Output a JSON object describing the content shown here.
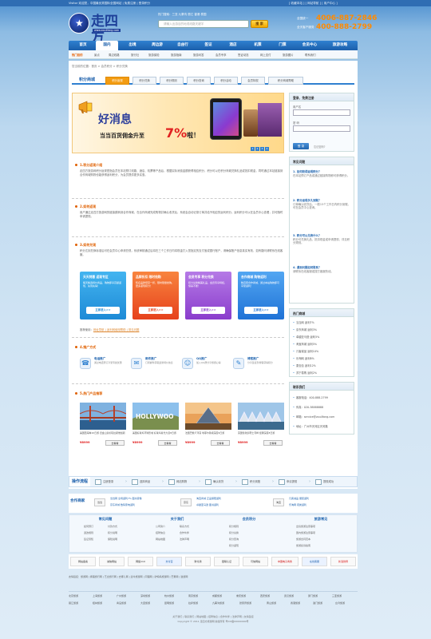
{
  "topbar": {
    "left": "Visitor 欢迎您，中国最优秀国际全国网站 | 免费注册 | 登录积分",
    "right": "[ 收藏本站 ] [ 网站导航 ] [ 用户中心 ]"
  },
  "logo": {
    "word": "走四方",
    "url": "www.zou4fang.com"
  },
  "search": {
    "hint": "热门搜索：三亚 九寨沟 丽江 香港 泰国",
    "placeholder": "请输入出游目的地或线路关键字",
    "button": "搜 索"
  },
  "hotline": [
    {
      "label": "全国统一",
      "number": "4006-887-2846"
    },
    {
      "label": "全天客户服务",
      "number": "400-888-2799"
    }
  ],
  "nav": [
    "首页",
    "国内",
    "出境",
    "周边游",
    "自由行",
    "签证",
    "酒店",
    "机票",
    "门票",
    "会员中心",
    "旅游攻略"
  ],
  "subnav": [
    "热门目的",
    "景点",
    "周边线路",
    "旅行社",
    "旅游保险",
    "旅游指南",
    "旅游问答",
    "会员专享",
    "签证动态",
    "网上支付",
    "旅游图片",
    "联系我们"
  ],
  "breadcrumb": "您当前的位置：首页 > 会员积分 > 积分兑换",
  "tabs": {
    "head": "积分商城",
    "items": [
      "积分返现",
      "积分兑换",
      "积分规则",
      "积分查询",
      "积分活动",
      "会员特权",
      "积分商城帮助"
    ]
  },
  "banner": {
    "title": "好消息",
    "sub": "当当百货佣金升至",
    "pct": "7%",
    "suffix": "啦！",
    "dots": [
      "1",
      "2",
      "3",
      "4"
    ]
  },
  "login": {
    "title": "登录、免费注册",
    "user_label": "用户名",
    "pass_label": "密 码",
    "login_btn": "登 录",
    "forgot": "忘记密码?"
  },
  "sections": [
    {
      "title": "1.积分返现介绍",
      "text": "走四方旅游网积分返现是指会员在本站预订线路、酒店、机票等产品后，根据实际消费金额获得相应积分，积分可以在积分商城兑换礼品或抵扣现金，同时通过本站链接到合作商城购物也能获得返利积分，为会员提供更多实惠。"
    },
    {
      "title": "2.如何返现",
      "text": "用户通过走四方旅游网的链接跳转到合作商城，在合作商城完成购物并确认收货后，系统会自动记录订单并给予相应的返利积分。返利积分可以在会员中心查看，并可随时申请提现。"
    },
    {
      "title": "3.如何兑现",
      "text": "积分达到兑换标准后可在会员中心申请兑现，系统审核通过后将在三个工作日内将现金打入您指定的支付宝或银行账户，请确保账户信息真实有效，如有疑问请联系在线客服。"
    },
    {
      "title": "4.推广方式",
      "text": ""
    },
    {
      "title": "5.热门产品推荐",
      "text": ""
    }
  ],
  "cards": [
    {
      "title": "天天特惠 返现专区",
      "text": "每天精选特价商品，购物即享高额返现，先到先得！",
      "button": "立即进入>>",
      "color": "#26a0e8"
    },
    {
      "title": "品牌折扣 限时抢购",
      "text": "知名品牌低至一折，限时限量抢购，更多返现积分！",
      "button": "立即进入>>",
      "color": "#f05a2a"
    },
    {
      "title": "会员专享 积分兑换",
      "text": "积分兑换精美礼品，会员专享特权，惊喜不断！",
      "button": "立即进入>>",
      "color": "#9a52d6"
    },
    {
      "title": "合作商城 购物返利",
      "text": "数百家合作商城，通过本站购物即可享受返利！",
      "button": "立即进入>>",
      "color": "#2f86e0"
    }
  ],
  "note": {
    "label": "推荐使用：",
    "link": "网址导航 | 返利网使用帮助 | 常见问题"
  },
  "promos": [
    {
      "icon": "☎",
      "title": "电话推广",
      "text": "通过电话预订享受专属优惠"
    },
    {
      "icon": "✉",
      "title": "邮件推广",
      "text": "订阅邮件获取最新特价信息"
    },
    {
      "icon": "☺",
      "title": "QQ推广",
      "text": "加入QQ群分享旅游心得"
    },
    {
      "icon": "✎",
      "title": "博客推广",
      "text": "分享链接到博客获得积分"
    }
  ],
  "products": [
    {
      "name": "美国西海岸10日游 旧金山洛杉矶拉斯维加斯",
      "price": "¥8999",
      "button": "去看看"
    },
    {
      "name": "美国好莱坞环球影城 好莱坞星光大道8日游",
      "price": "¥8999",
      "button": "去看看"
    },
    {
      "name": "法国巴黎卢浮宫 埃菲尔铁塔深度9日游",
      "price": "¥8999",
      "button": "去看看"
    },
    {
      "name": "英国伦敦泰晤士河畔 经典深度8日游",
      "price": "¥8999",
      "button": "去看看"
    }
  ],
  "faq": {
    "title": "常见问题",
    "items": [
      {
        "q": "1. 如何获得返现积分？",
        "a": "在本站预订产品或通过链接购物即可获得积分。"
      },
      {
        "q": "2. 积分返现多久到账？",
        "a": "订单确认收货后，一般15个工作日内积分到账，可在会员中心查询。"
      },
      {
        "q": "3. 积分可以兑换什么？",
        "a": "积分可兑换礼品、抵扣现金或申请提现，详见积分规则。"
      },
      {
        "q": "4. 遇到问题如何联系？",
        "a": "请联系在线客服或拨打客服热线。"
      }
    ]
  },
  "hot": {
    "title": "热门商城",
    "items": [
      "当当网 返利7%",
      "京东商城 返利3%",
      "卓越亚马逊 返利5%",
      "淘宝商城 返利5%",
      "凡客诚品 返利10%",
      "乐淘网 返利8%",
      "麦包包 返利12%",
      "苏宁易购 返利2%"
    ]
  },
  "contact": {
    "title": "联系我们",
    "items": [
      "客服电话：400-888-2799",
      "传真：020-38888888",
      "邮箱：service@zou4fang.com",
      "地址：广州市天河区天河路"
    ]
  },
  "flow": {
    "head": "操作流程",
    "steps": [
      "注册登录",
      "选择商品",
      "网站购物",
      "确认收货",
      "积分到账",
      "申请提现",
      "提现成功"
    ]
  },
  "partner": {
    "head": "合作商家",
    "logos": [
      "当当",
      "京东",
      "淘宝"
    ],
    "lines": [
      "当当网 全场返利7% 图书音像",
      "京东商城 数码家电返利",
      "淘宝商城 正品保障返利",
      "卓越亚马逊 图书返利",
      "凡客诚品 服装返利",
      "乐淘网 鞋类返利"
    ]
  },
  "footcols": [
    {
      "title": "常见问题",
      "items": [
        "如何预订",
        "付款方式",
        "退改规则",
        "积分说明",
        "签证须知",
        "保险说明"
      ]
    },
    {
      "title": "关于我们",
      "items": [
        "公司简介",
        "联系方式",
        "招聘信息",
        "合作伙伴",
        "网站地图",
        "法律声明"
      ]
    },
    {
      "title": "会员积分",
      "items": [
        "积分规则",
        "积分兑换",
        "积分查询",
        "积分返现"
      ]
    },
    {
      "title": "旅游常见",
      "items": [
        "出境旅游注意事项",
        "国内旅游注意事项",
        "旅游合同范本",
        "旅游投诉指南"
      ]
    }
  ],
  "badges": [
    "网站备案",
    "诚信网站",
    "网络110",
    "支付宝",
    "财付通",
    "银联认证",
    "可信网站",
    "中国电子商务",
    "在线客服",
    "新浪微博"
  ],
  "links": [
    "友情链接：旅游网 | 携程旅行网 | 艺龙旅行网 | 去哪儿网 | 途牛旅游网 | 同程网 | 驴妈妈旅游网 | 芒果网 | 遨游网"
  ],
  "linkgrid": [
    "北京旅游",
    "上海旅游",
    "广州旅游",
    "深圳旅游",
    "杭州旅游",
    "南京旅游",
    "成都旅游",
    "重庆旅游",
    "西安旅游",
    "武汉旅游",
    "厦门旅游",
    "三亚旅游",
    "丽江旅游",
    "桂林旅游",
    "青岛旅游",
    "大连旅游",
    "昆明旅游",
    "拉萨旅游",
    "九寨沟旅游",
    "张家界旅游",
    "黄山旅游",
    "香港旅游",
    "澳门旅游",
    "台湾旅游"
  ],
  "copyright": [
    "关于我们 | 联系我们 | 网站地图 | 招聘信息 | 合作伙伴 | 法律声明 | 友情链接",
    "Copyright © 2011 走四方旅游网 版权所有 粤ICP备00000000号"
  ]
}
